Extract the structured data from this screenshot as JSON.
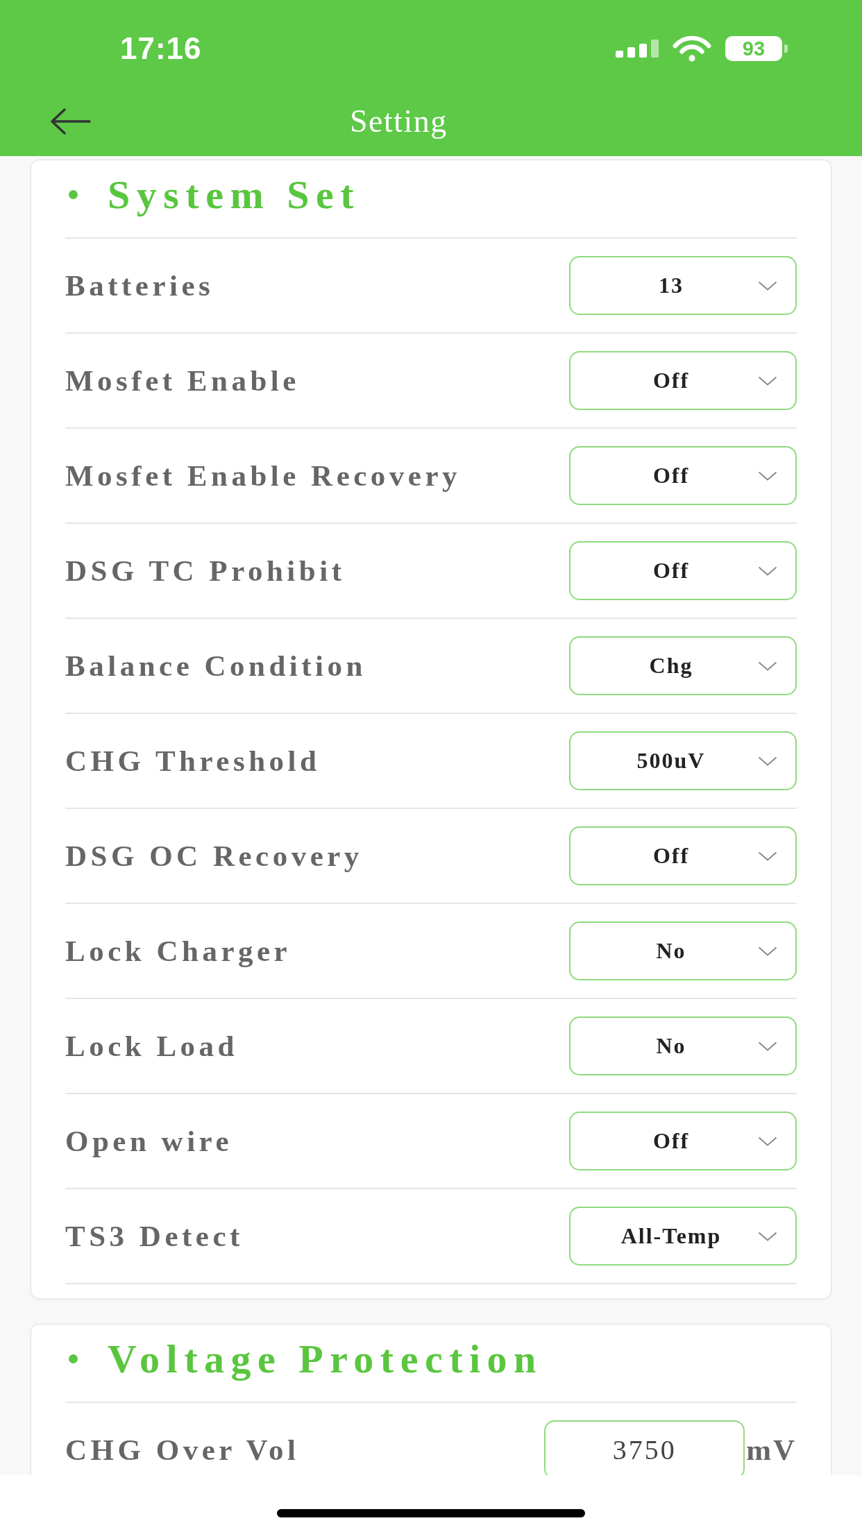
{
  "status_bar": {
    "time": "17:16",
    "battery": "93"
  },
  "header": {
    "title": "Setting"
  },
  "sections": [
    {
      "title": "System Set",
      "rows": [
        {
          "kind": "select",
          "label": "Batteries",
          "value": "13"
        },
        {
          "kind": "select",
          "label": "Mosfet Enable",
          "value": "Off"
        },
        {
          "kind": "select",
          "label": "Mosfet Enable Recovery",
          "value": "Off"
        },
        {
          "kind": "select",
          "label": "DSG TC Prohibit",
          "value": "Off"
        },
        {
          "kind": "select",
          "label": "Balance Condition",
          "value": "Chg"
        },
        {
          "kind": "select",
          "label": "CHG Threshold",
          "value": "500uV"
        },
        {
          "kind": "select",
          "label": "DSG OC Recovery",
          "value": "Off"
        },
        {
          "kind": "select",
          "label": "Lock Charger",
          "value": "No"
        },
        {
          "kind": "select",
          "label": "Lock Load",
          "value": "No"
        },
        {
          "kind": "select",
          "label": "Open wire",
          "value": "Off"
        },
        {
          "kind": "select",
          "label": "TS3 Detect",
          "value": "All-Temp"
        }
      ]
    },
    {
      "title": "Voltage Protection",
      "rows": [
        {
          "kind": "input",
          "label": "CHG Over Vol",
          "value": "3750",
          "unit": "mV"
        }
      ]
    }
  ]
}
